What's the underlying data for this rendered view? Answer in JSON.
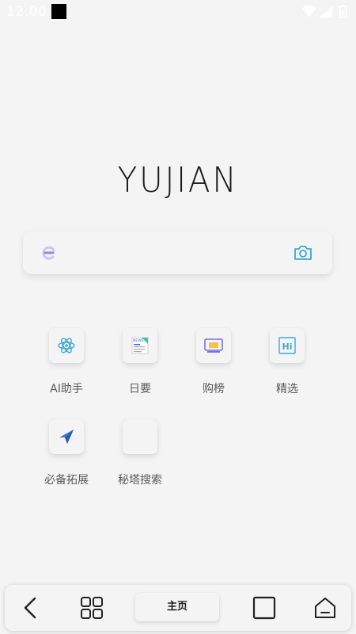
{
  "status_bar": {
    "time": "12:00"
  },
  "logo": {
    "text": "YUJIAN"
  },
  "search": {
    "value": "",
    "placeholder": ""
  },
  "shortcuts": [
    {
      "label": "AI助手",
      "icon": "atom-icon"
    },
    {
      "label": "日要",
      "icon": "news-icon"
    },
    {
      "label": "购榜",
      "icon": "shopping-rank-icon"
    },
    {
      "label": "精选",
      "icon": "hi-icon"
    },
    {
      "label": "必备拓展",
      "icon": "extension-arrow-icon"
    },
    {
      "label": "秘塔搜索",
      "icon": "blank-tile"
    }
  ],
  "bottom_nav": {
    "home_label": "主页"
  },
  "colors": {
    "accent": "#3aa9d6",
    "background": "#f4f4f4",
    "logo": "#1b1b1b"
  }
}
